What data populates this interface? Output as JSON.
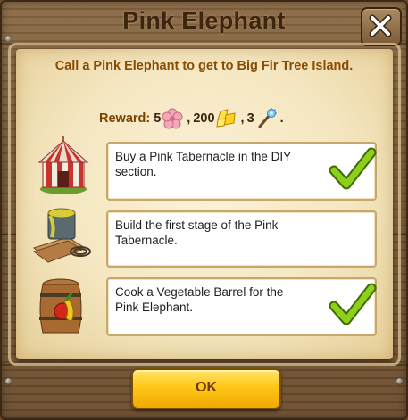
{
  "dialog": {
    "title": "Pink Elephant",
    "headline": "Call a Pink Elephant to get to Big Fir Tree Island.",
    "ok_label": "OK"
  },
  "reward": {
    "label": "Reward:",
    "items": [
      {
        "amount": "5",
        "icon": "pink-flower-icon"
      },
      {
        "amount": "200",
        "icon": "gold-coins-icon"
      },
      {
        "amount": "3",
        "icon": "magic-wand-icon"
      }
    ],
    "separator": ",",
    "end": "."
  },
  "tasks": [
    {
      "text": "Buy a Pink Tabernacle in the DIY section.",
      "icon": "tabernacle-tent-icon",
      "completed": true
    },
    {
      "text": "Build the first stage of the Pink Tabernacle.",
      "icon": "building-materials-icon",
      "completed": false
    },
    {
      "text": "Cook a Vegetable Barrel for the Pink Elephant.",
      "icon": "vegetable-barrel-icon",
      "completed": true
    }
  ],
  "colors": {
    "headline": "#8a4c00",
    "check": "#8ecf1a",
    "ok_button": "#ffc718"
  }
}
